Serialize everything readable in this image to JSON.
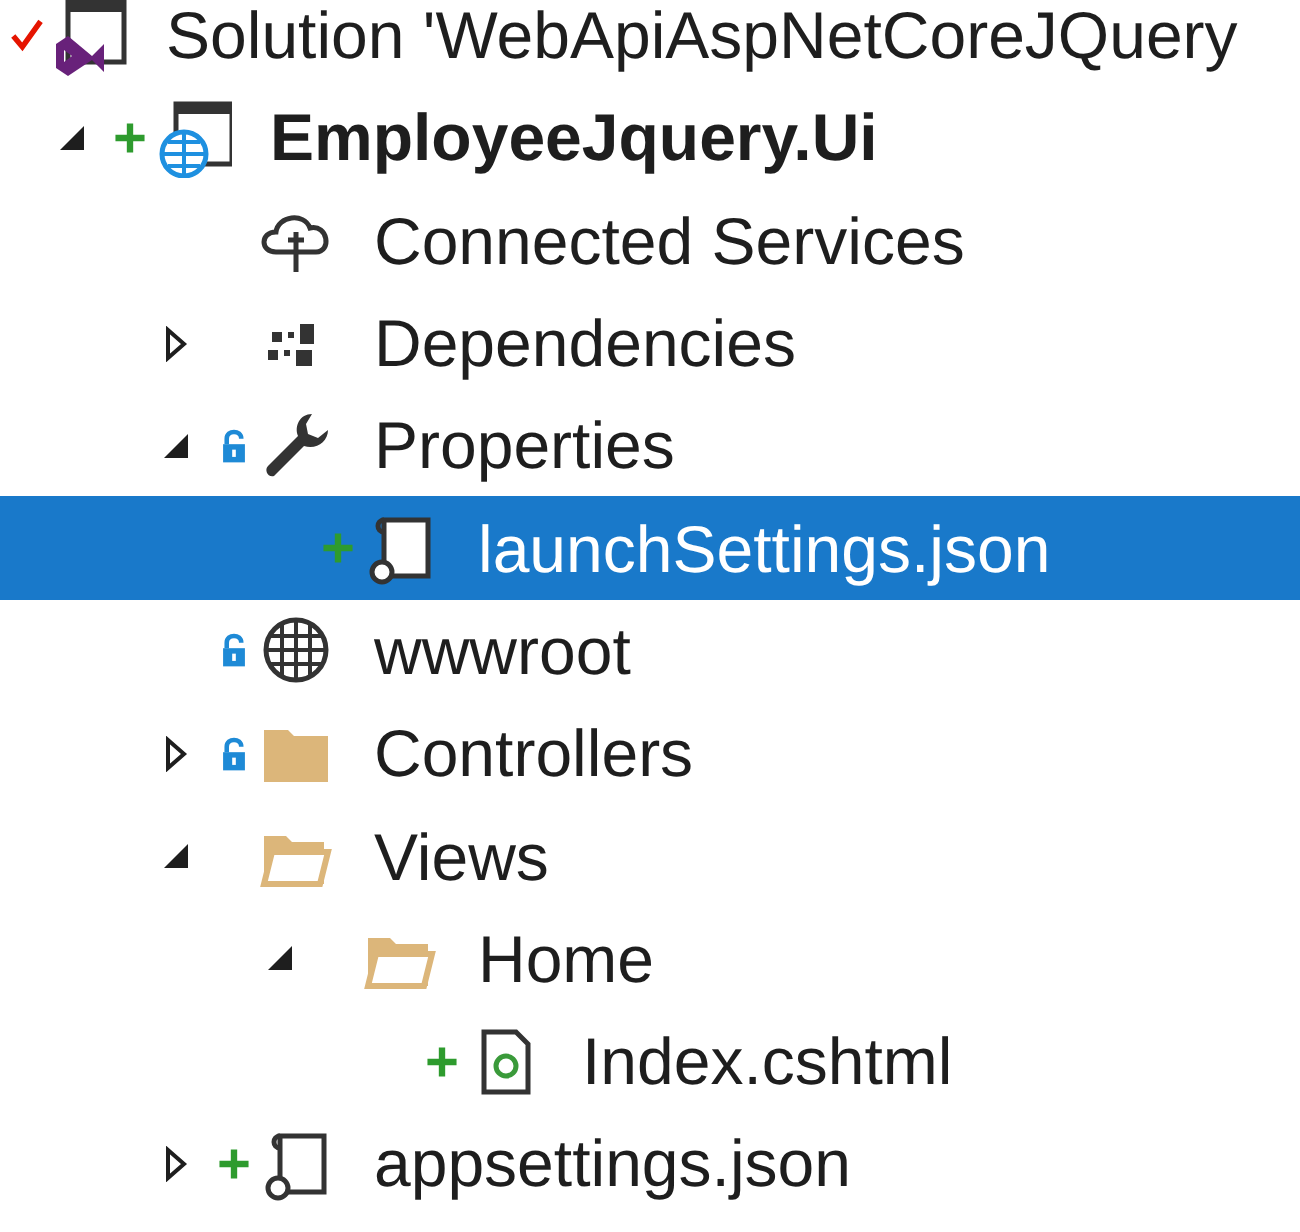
{
  "solution_explorer": {
    "tree": [
      {
        "label": "Solution 'WebApiAspNetCoreJQuery",
        "kind": "solution",
        "checked_in": true,
        "added": false,
        "locked": false,
        "selected": false,
        "children": [
          {
            "label": "EmployeeJquery.Ui",
            "kind": "web-project",
            "checked_in": false,
            "added": true,
            "locked": false,
            "expanded": true,
            "selected": false,
            "children": [
              {
                "label": "Connected Services",
                "kind": "connected-services",
                "checked_in": false,
                "added": false,
                "locked": false,
                "selected": false
              },
              {
                "label": "Dependencies",
                "kind": "dependencies",
                "checked_in": false,
                "added": false,
                "locked": false,
                "expanded": false,
                "selected": false
              },
              {
                "label": "Properties",
                "kind": "properties",
                "checked_in": false,
                "added": false,
                "locked": true,
                "expanded": true,
                "selected": false,
                "children": [
                  {
                    "label": "launchSettings.json",
                    "kind": "json",
                    "checked_in": false,
                    "added": true,
                    "locked": false,
                    "selected": true
                  }
                ]
              },
              {
                "label": "wwwroot",
                "kind": "wwwroot",
                "checked_in": false,
                "added": false,
                "locked": true,
                "selected": false
              },
              {
                "label": "Controllers",
                "kind": "folder",
                "checked_in": false,
                "added": false,
                "locked": true,
                "expanded": false,
                "selected": false
              },
              {
                "label": "Views",
                "kind": "folder-open",
                "checked_in": false,
                "added": false,
                "locked": false,
                "expanded": true,
                "selected": false,
                "children": [
                  {
                    "label": "Home",
                    "kind": "folder-open",
                    "checked_in": false,
                    "added": false,
                    "locked": false,
                    "expanded": true,
                    "selected": false,
                    "children": [
                      {
                        "label": "Index.cshtml",
                        "kind": "cshtml",
                        "checked_in": false,
                        "added": true,
                        "locked": false,
                        "selected": false
                      }
                    ]
                  }
                ]
              },
              {
                "label": "appsettings.json",
                "kind": "json",
                "checked_in": false,
                "added": true,
                "locked": false,
                "expanded": false,
                "selected": false
              }
            ]
          }
        ]
      }
    ]
  }
}
